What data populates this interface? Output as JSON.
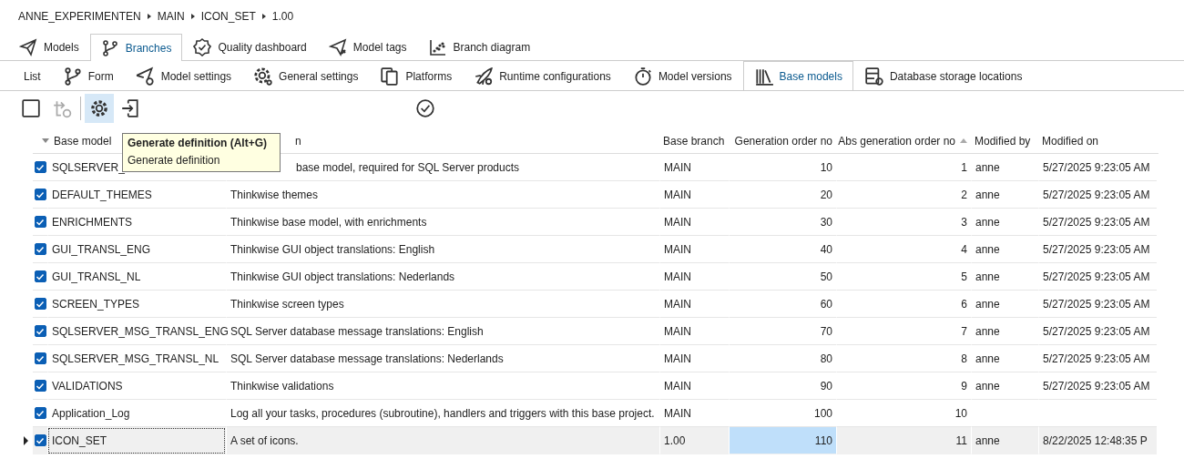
{
  "breadcrumb": [
    "ANNE_EXPERIMENTEN",
    "MAIN",
    "ICON_SET",
    "1.00"
  ],
  "tabs": [
    {
      "label": "Models",
      "selected": false
    },
    {
      "label": "Branches",
      "selected": true
    },
    {
      "label": "Quality dashboard",
      "selected": false
    },
    {
      "label": "Model tags",
      "selected": false
    },
    {
      "label": "Branch diagram",
      "selected": false
    }
  ],
  "subtabs": [
    {
      "label": "List",
      "selected": false
    },
    {
      "label": "Form",
      "selected": false
    },
    {
      "label": "Model settings",
      "selected": false
    },
    {
      "label": "General settings",
      "selected": false
    },
    {
      "label": "Platforms",
      "selected": false
    },
    {
      "label": "Runtime configurations",
      "selected": false
    },
    {
      "label": "Model versions",
      "selected": false
    },
    {
      "label": "Base models",
      "selected": true
    },
    {
      "label": "Database storage locations",
      "selected": false
    }
  ],
  "toolbar": [
    {
      "kind": "checkbox"
    },
    {
      "kind": "refresh",
      "disabled": true
    },
    {
      "kind": "separator"
    },
    {
      "kind": "gear",
      "active": true
    },
    {
      "kind": "exit"
    },
    {
      "kind": "check"
    }
  ],
  "tooltip": {
    "title": "Generate definition (Alt+G)",
    "text": "Generate definition"
  },
  "table": {
    "columns": [
      {
        "label": "Base model",
        "sorted_descending": true
      },
      {
        "label": "n",
        "partial": true
      },
      {
        "label": "Base branch"
      },
      {
        "label": "Generation order no"
      },
      {
        "label": "Abs generation order no",
        "sorted_ascending": true
      },
      {
        "label": "Modified by"
      },
      {
        "label": "Modified on"
      }
    ],
    "rows": [
      {
        "checked": true,
        "selected": false,
        "partial": true,
        "cells": [
          "SQLSERVER_",
          "base model, required for SQL Server products",
          "MAIN",
          "10",
          "1",
          "anne",
          "5/27/2025 9:23:05 AM"
        ]
      },
      {
        "checked": true,
        "selected": false,
        "partial": false,
        "cells": [
          "DEFAULT_THEMES",
          "Thinkwise themes",
          "MAIN",
          "20",
          "2",
          "anne",
          "5/27/2025 9:23:05 AM"
        ]
      },
      {
        "checked": true,
        "selected": false,
        "partial": false,
        "cells": [
          "ENRICHMENTS",
          "Thinkwise base model, with enrichments",
          "MAIN",
          "30",
          "3",
          "anne",
          "5/27/2025 9:23:05 AM"
        ]
      },
      {
        "checked": true,
        "selected": false,
        "partial": false,
        "cells": [
          "GUI_TRANSL_ENG",
          "Thinkwise GUI object translations: English",
          "MAIN",
          "40",
          "4",
          "anne",
          "5/27/2025 9:23:05 AM"
        ]
      },
      {
        "checked": true,
        "selected": false,
        "partial": false,
        "cells": [
          "GUI_TRANSL_NL",
          "Thinkwise GUI object translations: Nederlands",
          "MAIN",
          "50",
          "5",
          "anne",
          "5/27/2025 9:23:05 AM"
        ]
      },
      {
        "checked": true,
        "selected": false,
        "partial": false,
        "cells": [
          "SCREEN_TYPES",
          "Thinkwise screen types",
          "MAIN",
          "60",
          "6",
          "anne",
          "5/27/2025 9:23:05 AM"
        ]
      },
      {
        "checked": true,
        "selected": false,
        "partial": false,
        "cells": [
          "SQLSERVER_MSG_TRANSL_ENG",
          "SQL Server database message translations: English",
          "MAIN",
          "70",
          "7",
          "anne",
          "5/27/2025 9:23:05 AM"
        ]
      },
      {
        "checked": true,
        "selected": false,
        "partial": false,
        "cells": [
          "SQLSERVER_MSG_TRANSL_NL",
          "SQL Server database message translations: Nederlands",
          "MAIN",
          "80",
          "8",
          "anne",
          "5/27/2025 9:23:05 AM"
        ]
      },
      {
        "checked": true,
        "selected": false,
        "partial": false,
        "cells": [
          "VALIDATIONS",
          "Thinkwise validations",
          "MAIN",
          "90",
          "9",
          "anne",
          "5/27/2025 9:23:05 AM"
        ]
      },
      {
        "checked": true,
        "selected": false,
        "partial": false,
        "cells": [
          "Application_Log",
          "Log all your tasks, procedures (subroutine), handlers and triggers with this base project.",
          "MAIN",
          "100",
          "10"
        ]
      },
      {
        "checked": true,
        "selected": true,
        "partial": false,
        "cells": [
          "ICON_SET",
          "A set of icons.",
          "1.00",
          "110",
          "11",
          "anne",
          "8/22/2025 12:48:35 P"
        ]
      }
    ]
  }
}
